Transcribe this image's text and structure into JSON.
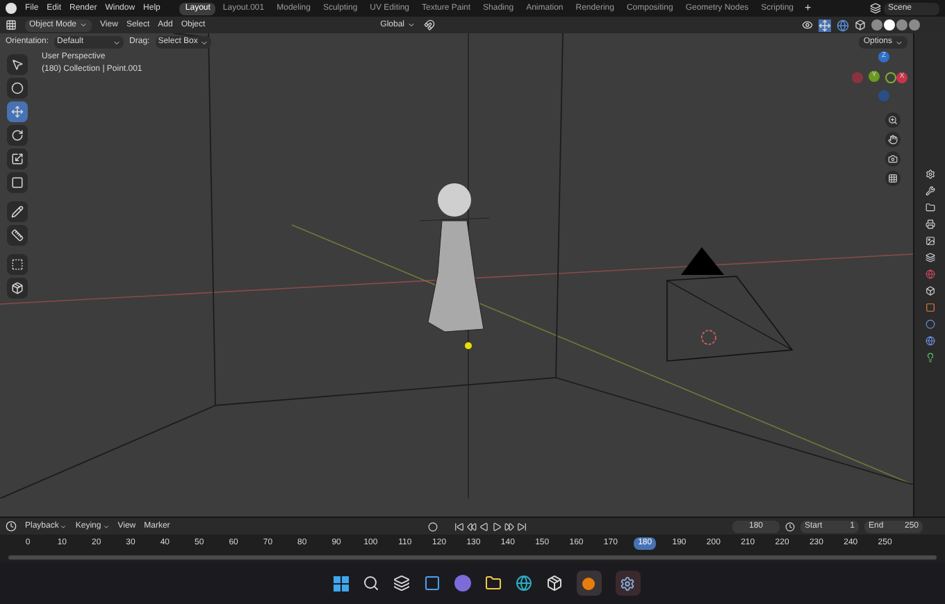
{
  "menu": [
    "File",
    "Edit",
    "Render",
    "Window",
    "Help"
  ],
  "workspaces": [
    {
      "label": "Layout",
      "selected": true
    },
    {
      "label": "Layout.001",
      "selected": false
    },
    {
      "label": "Modeling",
      "selected": false
    },
    {
      "label": "Sculpting",
      "selected": false
    },
    {
      "label": "UV Editing",
      "selected": false
    },
    {
      "label": "Texture Paint",
      "selected": false
    },
    {
      "label": "Shading",
      "selected": false
    },
    {
      "label": "Animation",
      "selected": false
    },
    {
      "label": "Rendering",
      "selected": false
    },
    {
      "label": "Compositing",
      "selected": false
    },
    {
      "label": "Geometry Nodes",
      "selected": false
    },
    {
      "label": "Scripting",
      "selected": false
    }
  ],
  "add_workspace": "+",
  "scene": "Scene",
  "header": {
    "mode": "Object Mode",
    "menus": [
      "View",
      "Select",
      "Add",
      "Object"
    ],
    "transform": "Global"
  },
  "shading": [
    {
      "selected": false
    },
    {
      "selected": true
    },
    {
      "selected": false
    },
    {
      "selected": false
    }
  ],
  "tool_settings": {
    "orientation_label": "Orientation:",
    "orientation": "Default",
    "drag_label": "Drag:",
    "drag": "Select Box",
    "options": "Options"
  },
  "toolbar": [
    {
      "kind": "select",
      "selected": false
    },
    {
      "kind": "cursor",
      "selected": false
    },
    {
      "kind": "move",
      "selected": true
    },
    {
      "kind": "rotate",
      "selected": false
    },
    {
      "kind": "scale",
      "selected": false
    },
    {
      "kind": "transform",
      "selected": false
    },
    {
      "kind": "annotate",
      "selected": false
    },
    {
      "kind": "measure",
      "selected": false
    },
    {
      "kind": "add",
      "selected": false
    },
    {
      "kind": "extrude",
      "selected": false
    }
  ],
  "viewport": {
    "perspective": "User Perspective",
    "context": "(180) Collection | Point.001"
  },
  "gizmo": {
    "z": "Z",
    "y": "Y",
    "x": "X"
  },
  "timeline": {
    "menus": [
      "Playback",
      "Keying",
      "View",
      "Marker"
    ],
    "current_frame": "180",
    "start_label": "Start",
    "start": "1",
    "end_label": "End",
    "end": "250",
    "frames": [
      {
        "label": "0",
        "selected": false
      },
      {
        "label": "10",
        "selected": false
      },
      {
        "label": "20",
        "selected": false
      },
      {
        "label": "30",
        "selected": false
      },
      {
        "label": "40",
        "selected": false
      },
      {
        "label": "50",
        "selected": false
      },
      {
        "label": "60",
        "selected": false
      },
      {
        "label": "70",
        "selected": false
      },
      {
        "label": "80",
        "selected": false
      },
      {
        "label": "90",
        "selected": false
      },
      {
        "label": "100",
        "selected": false
      },
      {
        "label": "110",
        "selected": false
      },
      {
        "label": "120",
        "selected": false
      },
      {
        "label": "130",
        "selected": false
      },
      {
        "label": "140",
        "selected": false
      },
      {
        "label": "150",
        "selected": false
      },
      {
        "label": "160",
        "selected": false
      },
      {
        "label": "170",
        "selected": false
      },
      {
        "label": "180",
        "selected": true
      },
      {
        "label": "190",
        "selected": false
      },
      {
        "label": "200",
        "selected": false
      },
      {
        "label": "210",
        "selected": false
      },
      {
        "label": "220",
        "selected": false
      },
      {
        "label": "230",
        "selected": false
      },
      {
        "label": "240",
        "selected": false
      },
      {
        "label": "250",
        "selected": false
      }
    ]
  }
}
